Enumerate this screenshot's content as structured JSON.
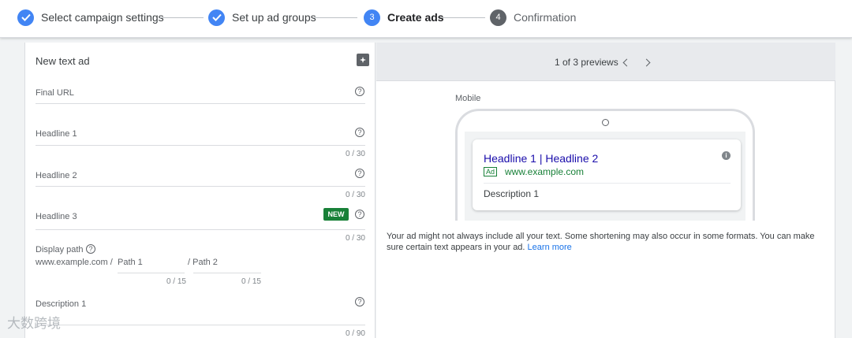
{
  "stepper": {
    "steps": [
      {
        "number": "",
        "label": "Select campaign settings",
        "state": "done"
      },
      {
        "number": "",
        "label": "Set up ad groups",
        "state": "done"
      },
      {
        "number": "3",
        "label": "Create ads",
        "state": "active"
      },
      {
        "number": "4",
        "label": "Confirmation",
        "state": "pending"
      }
    ]
  },
  "form": {
    "title": "New text ad",
    "new_badge": "NEW",
    "fields": {
      "final_url": {
        "label": "Final URL",
        "counter": ""
      },
      "headline1": {
        "label": "Headline 1",
        "counter": "0 / 30"
      },
      "headline2": {
        "label": "Headline 2",
        "counter": "0 / 30"
      },
      "headline3": {
        "label": "Headline 3",
        "counter": "0 / 30"
      },
      "display_path": {
        "label": "Display path",
        "base": "www.example.com /",
        "path1": "Path 1",
        "path2": "/ Path 2",
        "path1_counter": "0 / 15",
        "path2_counter": "0 / 15"
      },
      "description1": {
        "label": "Description 1",
        "counter": "0 / 90"
      }
    }
  },
  "preview": {
    "pager": "1 of 3 previews",
    "device_label": "Mobile",
    "ad": {
      "headline": "Headline 1 | Headline 2",
      "ad_tag": "Ad",
      "url": "www.example.com",
      "description": "Description 1"
    },
    "note": "Your ad might not always include all your text. Some shortening may also occur in some formats. You can make sure certain text appears in your ad.",
    "learn_more": "Learn more"
  },
  "watermark": "大数跨境",
  "colors": {
    "accent": "#4285f4",
    "green": "#188038",
    "link": "#1a73e8"
  }
}
